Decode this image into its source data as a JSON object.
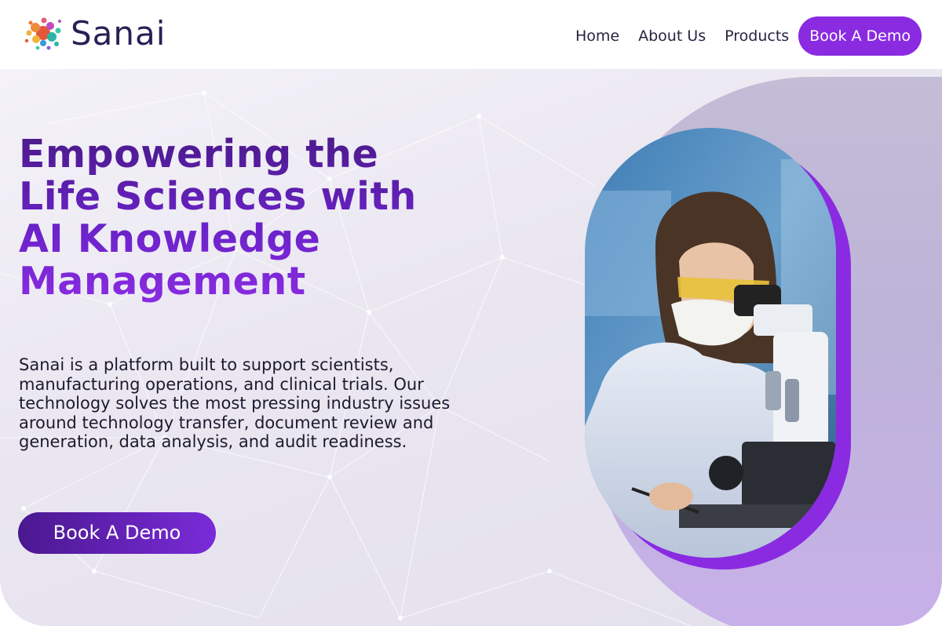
{
  "brand": {
    "name": "Sanai",
    "logo_icon": "molecule-logo-icon"
  },
  "nav": {
    "items": [
      {
        "label": "Home"
      },
      {
        "label": "About Us"
      },
      {
        "label": "Products"
      }
    ],
    "cta_label": "Book A Demo"
  },
  "hero": {
    "headline": "Empowering the Life Sciences with AI Knowledge Management",
    "body": "Sanai is a platform built to support scientists, manufacturing operations, and clinical trials. Our technology solves the most pressing industry issues around technology transfer, document review and generation, data analysis, and audit readiness.",
    "cta_label": "Book A Demo",
    "image": "scientist-microscope-photo"
  },
  "colors": {
    "accent": "#8a2be2",
    "headline_dark": "#4b1a8a",
    "text": "#1e1a2e",
    "nav_text": "#2a2340"
  }
}
